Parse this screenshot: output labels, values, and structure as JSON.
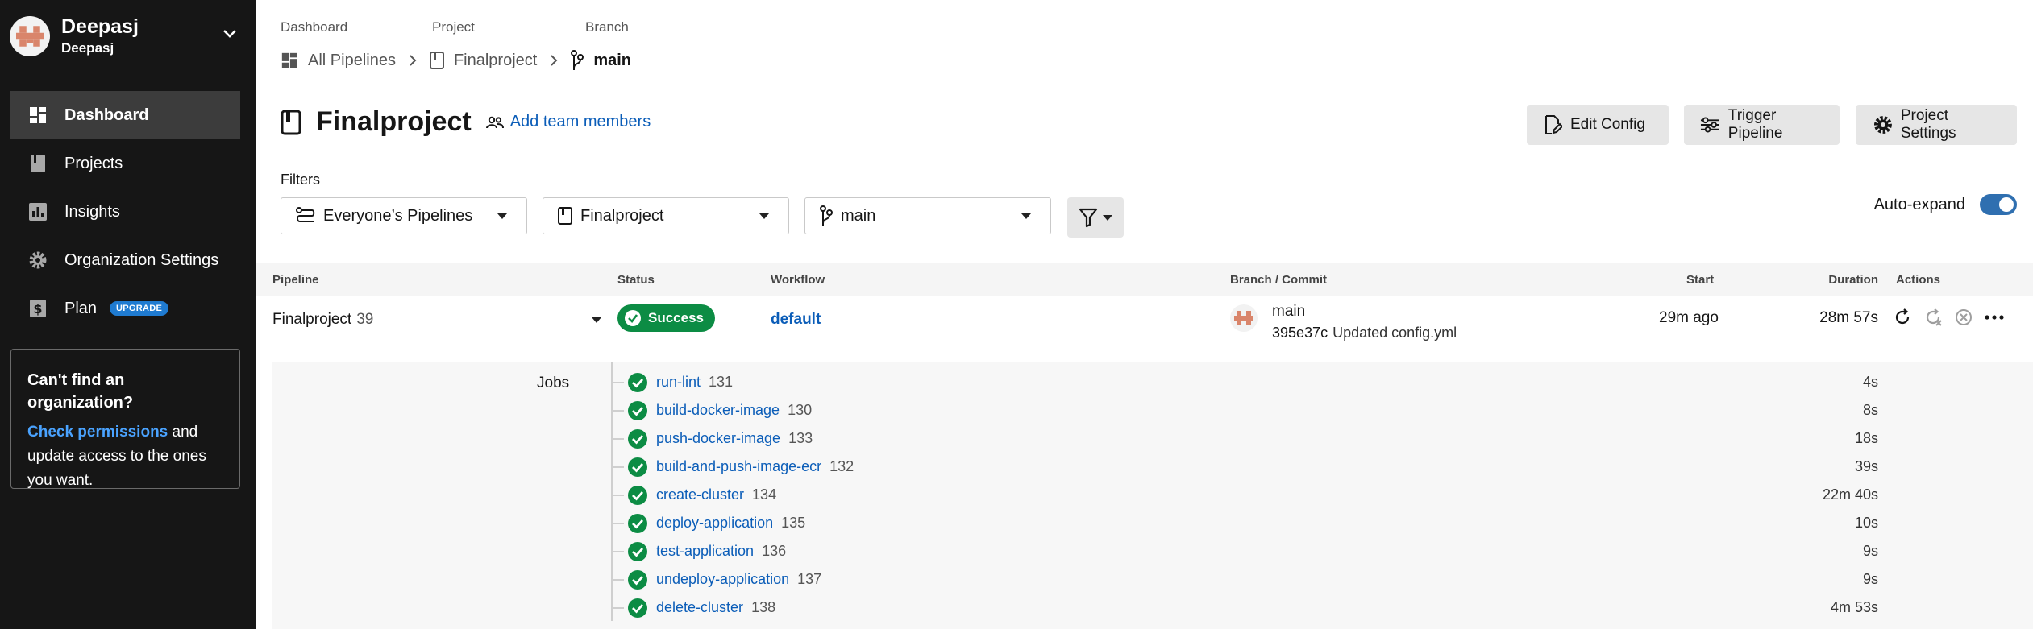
{
  "sidebar": {
    "org_name": "Deepasj",
    "org_sub": "Deepasj",
    "items": [
      {
        "label": "Dashboard",
        "icon": "dashboard-icon",
        "active": true
      },
      {
        "label": "Projects",
        "icon": "book-icon"
      },
      {
        "label": "Insights",
        "icon": "bar-chart-icon"
      },
      {
        "label": "Organization Settings",
        "icon": "gear-icon"
      },
      {
        "label": "Plan",
        "icon": "dollar-icon",
        "badge": "UPGRADE"
      }
    ],
    "help": {
      "title": "Can't find an organization?",
      "link": "Check permissions",
      "text": " and update access to the ones you want."
    }
  },
  "breadcrumb": {
    "labels": [
      "Dashboard",
      "Project",
      "Branch"
    ],
    "items": [
      "All Pipelines",
      "Finalproject",
      "main"
    ]
  },
  "header": {
    "title": "Finalproject",
    "add_team": "Add team members",
    "buttons": {
      "edit_config": "Edit Config",
      "trigger": "Trigger Pipeline",
      "settings": "Project Settings"
    }
  },
  "filters": {
    "label": "Filters",
    "pipelines": "Everyone’s Pipelines",
    "project": "Finalproject",
    "branch": "main",
    "auto_expand": "Auto-expand",
    "auto_expand_on": true
  },
  "table": {
    "headers": [
      "Pipeline",
      "Status",
      "Workflow",
      "Branch / Commit",
      "Start",
      "Duration",
      "Actions"
    ],
    "pipeline": {
      "name": "Finalproject",
      "number": "39",
      "status": "Success",
      "workflow": "default",
      "branch": "main",
      "commit_hash": "395e37c",
      "commit_msg": "Updated config.yml",
      "start": "29m ago",
      "duration": "28m 57s"
    },
    "jobs_label": "Jobs",
    "jobs": [
      {
        "name": "run-lint",
        "num": "131",
        "dur": "4s"
      },
      {
        "name": "build-docker-image",
        "num": "130",
        "dur": "8s"
      },
      {
        "name": "push-docker-image",
        "num": "133",
        "dur": "18s"
      },
      {
        "name": "build-and-push-image-ecr",
        "num": "132",
        "dur": "39s"
      },
      {
        "name": "create-cluster",
        "num": "134",
        "dur": "22m 40s"
      },
      {
        "name": "deploy-application",
        "num": "135",
        "dur": "10s"
      },
      {
        "name": "test-application",
        "num": "136",
        "dur": "9s"
      },
      {
        "name": "undeploy-application",
        "num": "137",
        "dur": "9s"
      },
      {
        "name": "delete-cluster",
        "num": "138",
        "dur": "4m 53s"
      }
    ]
  },
  "colors": {
    "success": "#0c8c44",
    "link": "#0b5db8",
    "sidebar_bg": "#161616",
    "toggle": "#2f6fb0"
  }
}
